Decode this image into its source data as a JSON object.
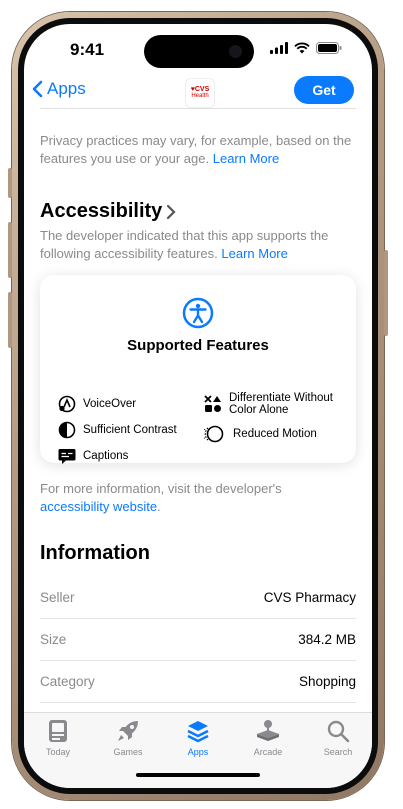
{
  "status_bar": {
    "time": "9:41"
  },
  "nav": {
    "back_label": "Apps",
    "app_logo_line1": "♥CVS",
    "app_logo_line2": "Health",
    "get_label": "Get"
  },
  "privacy": {
    "text": "Privacy practices may vary, for example, based on the features you use or your age.",
    "link": "Learn More"
  },
  "accessibility": {
    "title": "Accessibility",
    "description": "The developer indicated that this app supports the following accessibility features.",
    "link": "Learn More",
    "card_title": "Supported Features",
    "features": [
      {
        "label": "VoiceOver",
        "icon": "voiceover-icon"
      },
      {
        "label": "Differentiate Without Color Alone",
        "icon": "shapes-icon"
      },
      {
        "label": "Sufficient Contrast",
        "icon": "contrast-icon"
      },
      {
        "label": "Reduced Motion",
        "icon": "reduced-motion-icon"
      },
      {
        "label": "Captions",
        "icon": "captions-icon"
      }
    ]
  },
  "more_info": {
    "text": "For more information, visit the developer's",
    "link": "accessibility website"
  },
  "information": {
    "title": "Information",
    "rows": [
      {
        "key": "Seller",
        "value": "CVS Pharmacy"
      },
      {
        "key": "Size",
        "value": "384.2 MB"
      },
      {
        "key": "Category",
        "value": "Shopping"
      }
    ]
  },
  "tabbar": {
    "tabs": [
      {
        "label": "Today",
        "icon": "today-icon"
      },
      {
        "label": "Games",
        "icon": "rocket-icon"
      },
      {
        "label": "Apps",
        "icon": "apps-stack-icon",
        "active": true
      },
      {
        "label": "Arcade",
        "icon": "joystick-icon"
      },
      {
        "label": "Search",
        "icon": "search-icon"
      }
    ]
  },
  "colors": {
    "accent": "#0a7aff",
    "secondary_text": "#8a8a8e",
    "frame": "#b39a83"
  }
}
